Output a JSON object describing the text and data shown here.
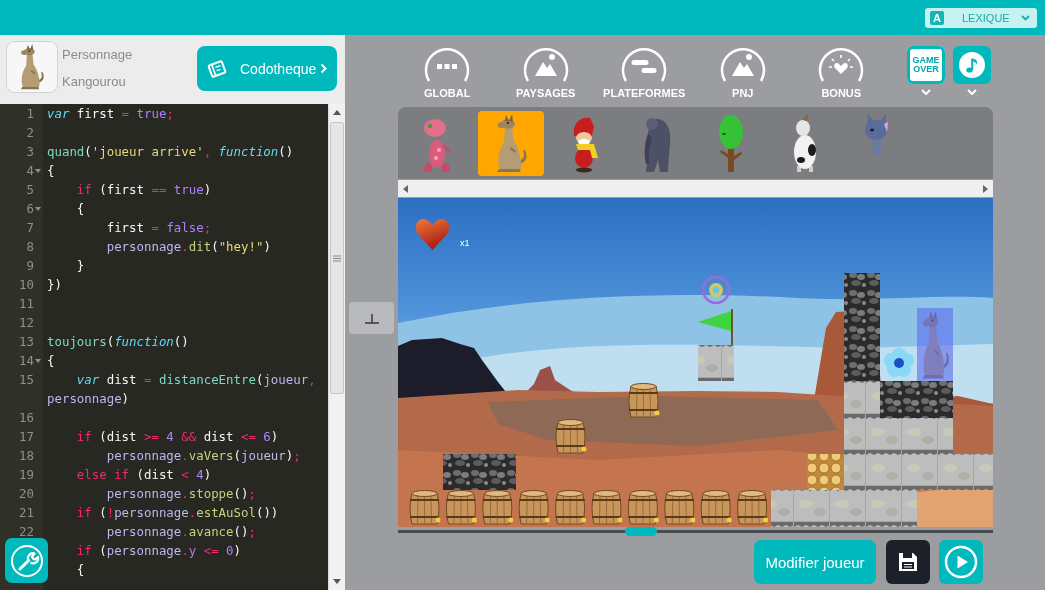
{
  "top_bar": {
    "lexique": {
      "badge": "A",
      "label": "LEXIQUE"
    }
  },
  "character_header": {
    "caption": "Personnage",
    "name": "Kangourou",
    "library_button": "Codotheque"
  },
  "editor": {
    "lines": [
      {
        "number": "1",
        "foldable": false,
        "tokens": [
          {
            "kind": "storage",
            "text": "var"
          },
          {
            "kind": "plain",
            "text": " first "
          },
          {
            "kind": "operator",
            "text": "="
          },
          {
            "kind": "constant",
            "text": " true"
          },
          {
            "kind": "operator",
            "text": ";"
          }
        ]
      },
      {
        "number": "2",
        "foldable": false
      },
      {
        "number": "3",
        "foldable": false,
        "tokens": [
          {
            "kind": "call",
            "text": "quand"
          },
          {
            "kind": "plain",
            "text": "("
          },
          {
            "kind": "string",
            "text": "'joueur arrive'"
          },
          {
            "kind": "operator",
            "text": ","
          },
          {
            "kind": "storage",
            "text": " function"
          },
          {
            "kind": "plain",
            "text": "()"
          }
        ]
      },
      {
        "number": "4",
        "foldable": true,
        "tokens": [
          {
            "kind": "plain",
            "text": "{"
          }
        ]
      },
      {
        "number": "5",
        "foldable": false,
        "tokens": [
          {
            "kind": "keyword",
            "text": "    if"
          },
          {
            "kind": "plain",
            "text": " (first "
          },
          {
            "kind": "operator",
            "text": "=="
          },
          {
            "kind": "constant",
            "text": " true"
          },
          {
            "kind": "plain",
            "text": ")"
          }
        ]
      },
      {
        "number": "6",
        "foldable": true,
        "tokens": [
          {
            "kind": "plain",
            "text": "    {"
          }
        ]
      },
      {
        "number": "7",
        "foldable": false,
        "tokens": [
          {
            "kind": "plain",
            "text": "        first "
          },
          {
            "kind": "operator",
            "text": "="
          },
          {
            "kind": "constant",
            "text": " false"
          },
          {
            "kind": "operator",
            "text": ";"
          }
        ]
      },
      {
        "number": "8",
        "foldable": false,
        "tokens": [
          {
            "kind": "object",
            "text": "        personnage"
          },
          {
            "kind": "operator",
            "text": "."
          },
          {
            "kind": "method",
            "text": "dit"
          },
          {
            "kind": "plain",
            "text": "("
          },
          {
            "kind": "string",
            "text": "\"hey!\""
          },
          {
            "kind": "plain",
            "text": ")"
          }
        ]
      },
      {
        "number": "9",
        "foldable": false,
        "tokens": [
          {
            "kind": "plain",
            "text": "    }"
          }
        ]
      },
      {
        "number": "10",
        "foldable": false,
        "tokens": [
          {
            "kind": "plain",
            "text": "})"
          }
        ]
      },
      {
        "number": "11",
        "foldable": false
      },
      {
        "number": "12",
        "foldable": false
      },
      {
        "number": "13",
        "foldable": false,
        "tokens": [
          {
            "kind": "call",
            "text": "toujours"
          },
          {
            "kind": "plain",
            "text": "("
          },
          {
            "kind": "storage",
            "text": "function"
          },
          {
            "kind": "plain",
            "text": "()"
          }
        ]
      },
      {
        "number": "14",
        "foldable": true,
        "tokens": [
          {
            "kind": "plain",
            "text": "{"
          }
        ]
      },
      {
        "number": "15",
        "foldable": false,
        "tokens": [
          {
            "kind": "storage",
            "text": "    var"
          },
          {
            "kind": "plain",
            "text": " dist "
          },
          {
            "kind": "operator",
            "text": "="
          },
          {
            "kind": "call",
            "text": " distanceEntre"
          },
          {
            "kind": "plain",
            "text": "("
          },
          {
            "kind": "object",
            "text": "joueur"
          },
          {
            "kind": "operator",
            "text": ","
          },
          {
            "kind": "object",
            "text": " personnage"
          },
          {
            "kind": "plain",
            "text": ")"
          }
        ]
      },
      {
        "number": "16",
        "foldable": false
      },
      {
        "number": "17",
        "foldable": false,
        "tokens": [
          {
            "kind": "keyword",
            "text": "    if"
          },
          {
            "kind": "plain",
            "text": " (dist "
          },
          {
            "kind": "operator",
            "text": ">="
          },
          {
            "kind": "constant",
            "text": " 4"
          },
          {
            "kind": "operator",
            "text": " &&"
          },
          {
            "kind": "plain",
            "text": " dist "
          },
          {
            "kind": "operator",
            "text": "<="
          },
          {
            "kind": "constant",
            "text": " 6"
          },
          {
            "kind": "plain",
            "text": ")"
          }
        ]
      },
      {
        "number": "18",
        "foldable": false,
        "tokens": [
          {
            "kind": "object",
            "text": "        personnage"
          },
          {
            "kind": "operator",
            "text": "."
          },
          {
            "kind": "method",
            "text": "vaVers"
          },
          {
            "kind": "plain",
            "text": "("
          },
          {
            "kind": "object",
            "text": "joueur"
          },
          {
            "kind": "plain",
            "text": ")"
          },
          {
            "kind": "operator",
            "text": ";"
          }
        ]
      },
      {
        "number": "19",
        "foldable": false,
        "tokens": [
          {
            "kind": "keyword",
            "text": "    else if"
          },
          {
            "kind": "plain",
            "text": " (dist "
          },
          {
            "kind": "operator",
            "text": "<"
          },
          {
            "kind": "constant",
            "text": " 4"
          },
          {
            "kind": "plain",
            "text": ")"
          }
        ]
      },
      {
        "number": "20",
        "foldable": false,
        "tokens": [
          {
            "kind": "object",
            "text": "        personnage"
          },
          {
            "kind": "operator",
            "text": "."
          },
          {
            "kind": "method",
            "text": "stoppe"
          },
          {
            "kind": "plain",
            "text": "()"
          },
          {
            "kind": "operator",
            "text": ";"
          }
        ]
      },
      {
        "number": "21",
        "foldable": false,
        "tokens": [
          {
            "kind": "keyword",
            "text": "    if"
          },
          {
            "kind": "plain",
            "text": " ("
          },
          {
            "kind": "operator",
            "text": "!"
          },
          {
            "kind": "object",
            "text": "personnage"
          },
          {
            "kind": "operator",
            "text": "."
          },
          {
            "kind": "method",
            "text": "estAuSol"
          },
          {
            "kind": "plain",
            "text": "())"
          }
        ]
      },
      {
        "number": "22",
        "foldable": false,
        "tokens": [
          {
            "kind": "object",
            "text": "        personnage"
          },
          {
            "kind": "operator",
            "text": "."
          },
          {
            "kind": "method",
            "text": "avance"
          },
          {
            "kind": "plain",
            "text": "()"
          },
          {
            "kind": "operator",
            "text": ";"
          }
        ]
      },
      {
        "foldable": false,
        "tokens": [
          {
            "kind": "keyword",
            "text": "    if"
          },
          {
            "kind": "plain",
            "text": " ("
          },
          {
            "kind": "object",
            "text": "personnage"
          },
          {
            "kind": "operator",
            "text": "."
          },
          {
            "kind": "property",
            "text": "y"
          },
          {
            "kind": "operator",
            "text": " <="
          },
          {
            "kind": "constant",
            "text": " 0"
          },
          {
            "kind": "plain",
            "text": ")"
          }
        ]
      },
      {
        "foldable": false,
        "tokens": [
          {
            "kind": "plain",
            "text": "    {"
          }
        ]
      }
    ]
  },
  "toolbar": {
    "categories": [
      {
        "kind": "global",
        "label": "GLOBAL",
        "selected": false
      },
      {
        "kind": "landscape",
        "label": "PAYSAGES",
        "selected": false
      },
      {
        "kind": "platform",
        "label": "PLATEFORMES",
        "selected": false
      },
      {
        "kind": "npc",
        "label": "PNJ",
        "selected": false
      },
      {
        "kind": "bonus",
        "label": "BONUS",
        "selected": false
      }
    ],
    "extras": [
      {
        "kind": "game_over",
        "label": "GAME OVER"
      },
      {
        "kind": "music"
      }
    ]
  },
  "characters": [
    {
      "kind": "creature",
      "selected": false
    },
    {
      "kind": "kangaroo",
      "selected": true
    },
    {
      "kind": "gnome",
      "selected": false
    },
    {
      "kind": "gorilla",
      "selected": false
    },
    {
      "kind": "tree",
      "selected": false
    },
    {
      "kind": "cow",
      "selected": false
    },
    {
      "kind": "cat",
      "selected": false
    }
  ],
  "scene": {
    "lives": "x1"
  },
  "actions": {
    "edit_player": "Modifier joueur"
  }
}
